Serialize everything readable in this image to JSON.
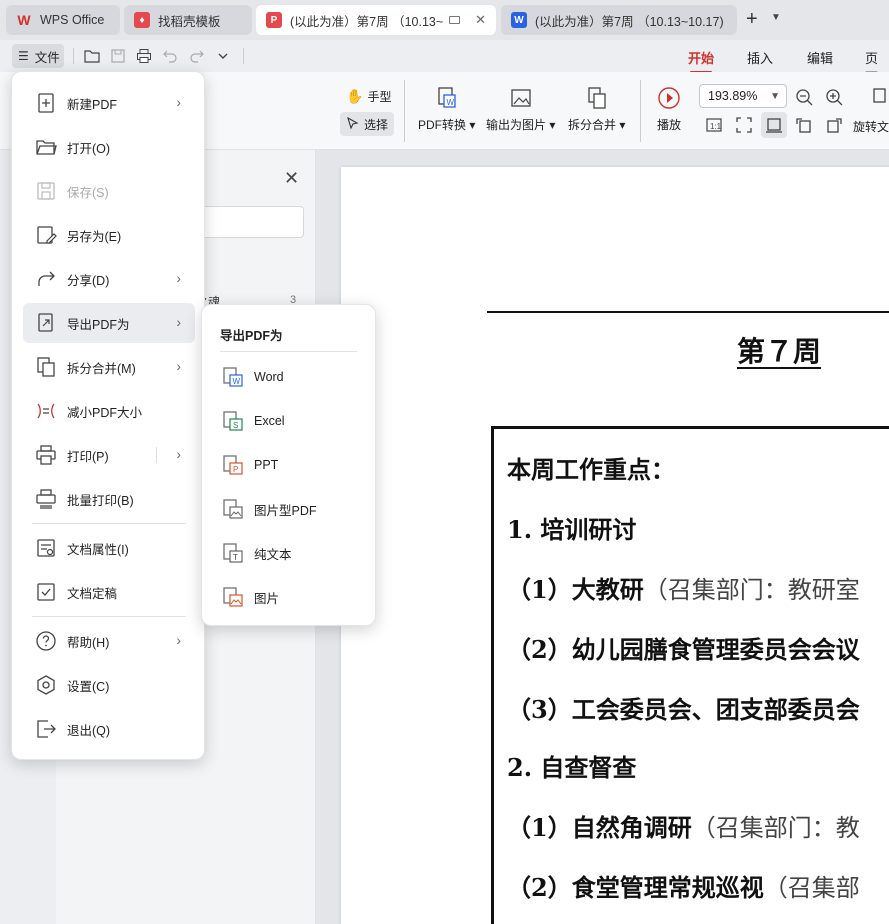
{
  "tabs": [
    {
      "label": "WPS Office",
      "icon": "wps-logo-icon",
      "color": "#d0312d"
    },
    {
      "label": "找稻壳模板",
      "icon": "daoke-icon",
      "color": "#e5484d"
    },
    {
      "label": "(以此为准）第7周 （10.13~",
      "icon": "pdf-icon",
      "color": "#e5484d"
    },
    {
      "label": "(以此为准）第7周 （10.13~10.17)",
      "icon": "word-icon",
      "color": "#2b62e5"
    }
  ],
  "toolbar": {
    "file_label": "文件",
    "ribbon_tabs": [
      "开始",
      "插入",
      "编辑",
      "页面"
    ],
    "hand_tool": "手型",
    "select_tool": "选择",
    "pdf_convert": "PDF转换",
    "export_image": "输出为图片",
    "split_merge": "拆分合并",
    "play": "播放",
    "zoom_value": "193.89%",
    "rotate_doc": "旋转文"
  },
  "nav": {
    "item": "之魂",
    "item_number": "3"
  },
  "file_menu": {
    "items": [
      {
        "label": "新建PDF",
        "icon": "new-pdf-icon",
        "arrow": true
      },
      {
        "label": "打开(O)",
        "icon": "open-folder-icon",
        "arrow": false
      },
      {
        "label": "保存(S)",
        "icon": "save-icon",
        "arrow": false,
        "disabled": true
      },
      {
        "label": "另存为(E)",
        "icon": "save-as-icon",
        "arrow": false
      },
      {
        "label": "分享(D)",
        "icon": "share-icon",
        "arrow": true
      },
      {
        "label": "导出PDF为",
        "icon": "export-pdf-icon",
        "arrow": true,
        "hover": true
      },
      {
        "label": "拆分合并(M)",
        "icon": "split-merge-icon",
        "arrow": true
      },
      {
        "label": "减小PDF大小",
        "icon": "compress-icon",
        "arrow": false
      },
      {
        "label": "打印(P)",
        "icon": "print-icon",
        "arrow": true
      },
      {
        "label": "批量打印(B)",
        "icon": "batch-print-icon",
        "arrow": false
      },
      {
        "label": "文档属性(I)",
        "icon": "doc-properties-icon",
        "arrow": false
      },
      {
        "label": "文档定稿",
        "icon": "doc-finalize-icon",
        "arrow": false
      },
      {
        "label": "帮助(H)",
        "icon": "help-icon",
        "arrow": true
      },
      {
        "label": "设置(C)",
        "icon": "settings-icon",
        "arrow": false
      },
      {
        "label": "退出(Q)",
        "icon": "exit-icon",
        "arrow": false
      }
    ]
  },
  "submenu": {
    "title": "导出PDF为",
    "items": [
      {
        "label": "Word",
        "icon": "word-doc-icon"
      },
      {
        "label": "Excel",
        "icon": "excel-doc-icon"
      },
      {
        "label": "PPT",
        "icon": "ppt-doc-icon"
      },
      {
        "label": "图片型PDF",
        "icon": "image-pdf-icon"
      },
      {
        "label": "纯文本",
        "icon": "plain-text-icon"
      },
      {
        "label": "图片",
        "icon": "image-icon"
      }
    ]
  },
  "document": {
    "week_title": "第７周",
    "heading": "本周工作重点：",
    "lines": [
      {
        "bold": "1. 培训研讨",
        "gray": ""
      },
      {
        "bold": "（1）大教研",
        "gray": "（召集部门：教研室"
      },
      {
        "bold": "（2）幼儿园膳食管理委员会会议",
        "gray": ""
      },
      {
        "bold": "（3）工会委员会、团支部委员会",
        "gray": ""
      },
      {
        "bold": "2. 自查督查",
        "gray": ""
      },
      {
        "bold": "（1）自然角调研",
        "gray": "（召集部门：教"
      },
      {
        "bold": "（2）食堂管理常规巡视",
        "gray": "（召集部"
      }
    ]
  },
  "colors": {
    "accent": "#d0312d",
    "menu_hover": "#ebecef"
  }
}
